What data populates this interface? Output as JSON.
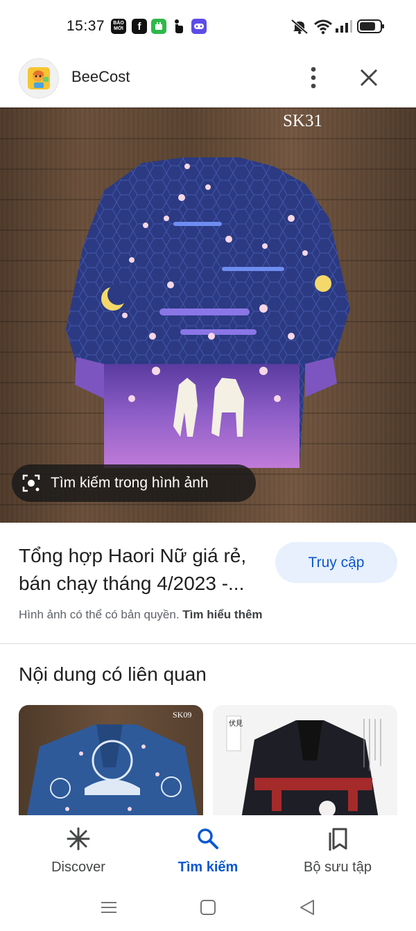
{
  "status_bar": {
    "time": "15:37",
    "notification_icons": [
      "baomoi-icon",
      "facebook-icon",
      "green-app-icon",
      "hand-touch-icon",
      "game-controller-icon"
    ],
    "notification_icon_labels": [
      "BÁO MỚI",
      "f"
    ],
    "system_icons": [
      "muted-bell-icon",
      "wifi-icon",
      "signal-icon",
      "battery-icon"
    ]
  },
  "header": {
    "app_name": "BeeCost",
    "logo": "beecost-logo"
  },
  "hero": {
    "watermark": "SK31",
    "lens_label": "Tìm kiếm trong hình ảnh"
  },
  "result": {
    "title": "Tổng hợp Haori Nữ giá rẻ, bán chạy tháng 4/2023 -...",
    "visit_button": "Truy cập",
    "copyright_text": "Hình ảnh có thể có bản quyền.",
    "learn_more": "Tìm hiểu thêm"
  },
  "related": {
    "title": "Nội dung có liên quan",
    "cards": [
      {
        "watermark": "SK09"
      },
      {
        "caption": "伏見"
      }
    ]
  },
  "bottom_nav": {
    "items": [
      {
        "label": "Discover",
        "icon": "asterisk-icon",
        "active": false
      },
      {
        "label": "Tìm kiếm",
        "icon": "search-icon",
        "active": true
      },
      {
        "label": "Bộ sưu tập",
        "icon": "collections-icon",
        "active": false
      }
    ]
  },
  "colors": {
    "accent": "#0b57d0",
    "visit_button_bg": "#e8f0fe",
    "divider": "#dadce0"
  }
}
